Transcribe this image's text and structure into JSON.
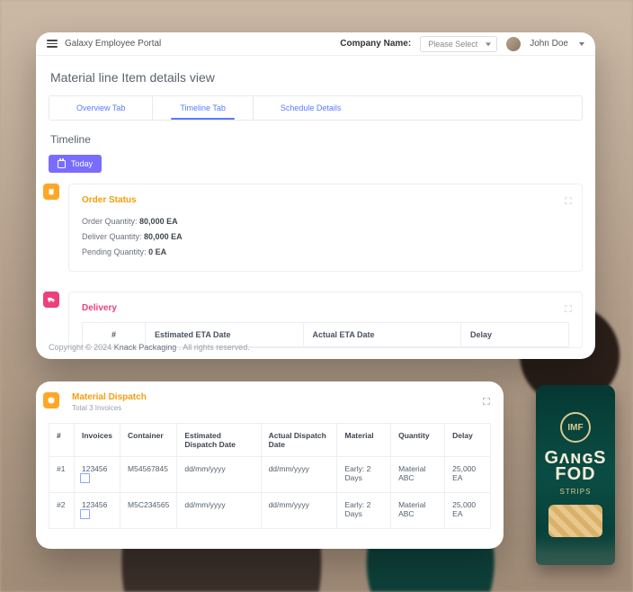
{
  "app": {
    "title": "Galaxy Employee Portal"
  },
  "header": {
    "company_label": "Company Name:",
    "company_select_placeholder": "Please Select",
    "user_name": "John Doe"
  },
  "page": {
    "title": "Material line Item details view"
  },
  "tabs": [
    {
      "label": "Overview Tab"
    },
    {
      "label": "Timeline Tab"
    },
    {
      "label": "Schedule Details"
    }
  ],
  "timeline": {
    "heading": "Timeline",
    "today_label": "Today"
  },
  "order_status": {
    "title": "Order Status",
    "order_qty_label": "Order Quantity:",
    "order_qty_value": "80,000 EA",
    "deliver_qty_label": "Deliver Quantity:",
    "deliver_qty_value": "80,000 EA",
    "pending_qty_label": "Pending Quantity:",
    "pending_qty_value": "0 EA"
  },
  "delivery": {
    "title": "Delivery",
    "columns": {
      "num": "#",
      "est": "Estimated ETA Date",
      "act": "Actual ETA Date",
      "delay": "Delay"
    }
  },
  "footer": {
    "copyright_prefix": "Copyright © 2024 ",
    "company": "Knack Packaging",
    "suffix": " . All rights reserved."
  },
  "dispatch": {
    "title": "Material Dispatch",
    "subtitle": "Total 3 Invoices",
    "columns": {
      "num": "#",
      "invoices": "Invoices",
      "container": "Container",
      "est": "Estimated Dispatch Date",
      "act": "Actual Dispatch Date",
      "material": "Material",
      "qty": "Quantity",
      "delay": "Delay"
    },
    "rows": [
      {
        "num": "#1",
        "invoice": "123456",
        "container": "M54567845",
        "est": "dd/mm/yyyy",
        "act": "dd/mm/yyyy",
        "material": "Early: 2 Days",
        "qty": "Material ABC",
        "delay": "25,000 EA"
      },
      {
        "num": "#2",
        "invoice": "123456",
        "container": "M5C234565",
        "est": "dd/mm/yyyy",
        "act": "dd/mm/yyyy",
        "material": "Early: 2 Days",
        "qty": "Material ABC",
        "delay": "25,000 EA"
      }
    ]
  },
  "pouch": {
    "brand_line1": "GʌɴɢS",
    "brand_line2": "FOD",
    "sub": "STRIPS",
    "badge": "IMF"
  }
}
